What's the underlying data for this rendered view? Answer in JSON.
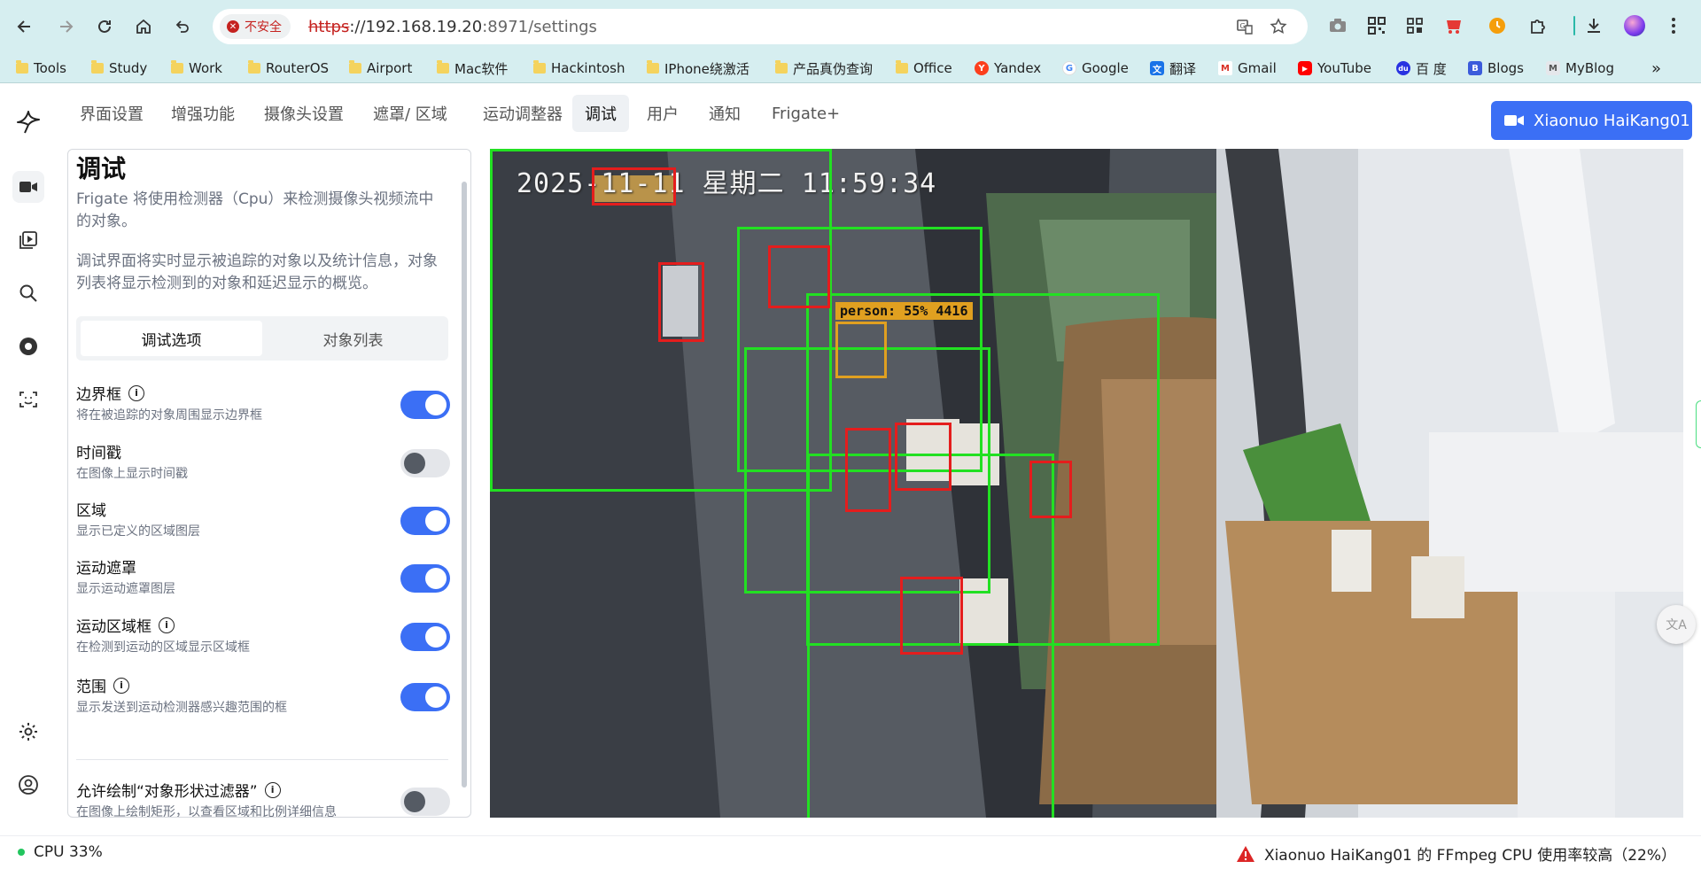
{
  "browser": {
    "security_label": "不安全",
    "url": {
      "scheme": "https",
      "host": "://192.168.19.20",
      "port_path": ":8971/settings"
    },
    "bookmarks": [
      {
        "label": "Tools",
        "type": "folder"
      },
      {
        "label": "Study",
        "type": "folder"
      },
      {
        "label": "Work",
        "type": "folder"
      },
      {
        "label": "RouterOS",
        "type": "folder"
      },
      {
        "label": "Airport",
        "type": "folder"
      },
      {
        "label": "Mac软件",
        "type": "folder"
      },
      {
        "label": "Hackintosh",
        "type": "folder"
      },
      {
        "label": "IPhone绕激活",
        "type": "folder"
      },
      {
        "label": "产品真伪查询",
        "type": "folder"
      },
      {
        "label": "Office",
        "type": "folder"
      },
      {
        "label": "Yandex",
        "type": "site",
        "icon": "yandex-icon",
        "color": "#fc3f1d",
        "glyph": "Y"
      },
      {
        "label": "Google",
        "type": "site",
        "icon": "google-icon",
        "color": "#4285f4",
        "glyph": "G"
      },
      {
        "label": "翻译",
        "type": "site",
        "icon": "translate-icon",
        "color": "#1a73e8",
        "glyph": "文"
      },
      {
        "label": "Gmail",
        "type": "site",
        "icon": "gmail-icon",
        "color": "#d93025",
        "glyph": "M"
      },
      {
        "label": "YouTube",
        "type": "site",
        "icon": "youtube-icon",
        "color": "#ff0000",
        "glyph": "▶"
      },
      {
        "label": "百 度",
        "type": "site",
        "icon": "baidu-icon",
        "color": "#2932e1",
        "glyph": "du"
      },
      {
        "label": "Blogs",
        "type": "site",
        "icon": "blogs-icon",
        "color": "#3b5bdb",
        "glyph": "B"
      },
      {
        "label": "MyBlog",
        "type": "site",
        "icon": "myblog-icon",
        "color": "#9ca3af",
        "glyph": "M"
      }
    ]
  },
  "nav": {
    "tabs": [
      "界面设置",
      "增强功能",
      "摄像头设置",
      "遮罩/ 区域",
      "运动调整器",
      "调试",
      "用户",
      "通知",
      "Frigate+"
    ],
    "active_tab": "调试",
    "camera_button": "Xiaonuo HaiKang01"
  },
  "panel": {
    "title": "调试",
    "intro": "Frigate 将使用检测器（Cpu）来检测摄像头视频流中的对象。",
    "intro2": "调试界面将实时显示被追踪的对象以及统计信息，对象列表将显示检测到的对象和延迟显示的概览。",
    "segments": [
      "调试选项",
      "对象列表"
    ],
    "active_segment": "调试选项",
    "options": [
      {
        "title": "边界框",
        "desc": "将在被追踪的对象周围显示边界框",
        "info": true,
        "enabled": true
      },
      {
        "title": "时间戳",
        "desc": "在图像上显示时间戳",
        "info": false,
        "enabled": false
      },
      {
        "title": "区域",
        "desc": "显示已定义的区域图层",
        "info": false,
        "enabled": true
      },
      {
        "title": "运动遮罩",
        "desc": "显示运动遮罩图层",
        "info": false,
        "enabled": true
      },
      {
        "title": "运动区域框",
        "desc": "在检测到运动的区域显示区域框",
        "info": true,
        "enabled": true
      },
      {
        "title": "范围",
        "desc": "显示发送到运动检测器感兴趣范围的框",
        "info": true,
        "enabled": true
      },
      {
        "title": "允许绘制“对象形状过滤器”",
        "desc": "在图像上绘制矩形，以查看区域和比例详细信息",
        "info": true,
        "enabled": false
      }
    ]
  },
  "video": {
    "timestamp": "2025-11-11  星期二  11:59:34",
    "detection_label": "person: 55% 4416"
  },
  "status": {
    "cpu": "CPU 33%",
    "alert": "Xiaonuo HaiKang01 的 FFmpeg CPU 使用率较高（22%）"
  },
  "colors": {
    "accent": "#3b6ff5",
    "motion_box": "#22e022",
    "region_box": "#e41d1d",
    "object_box": "#e0a020",
    "status_ok": "#22c55e",
    "alert": "#dc2626"
  }
}
